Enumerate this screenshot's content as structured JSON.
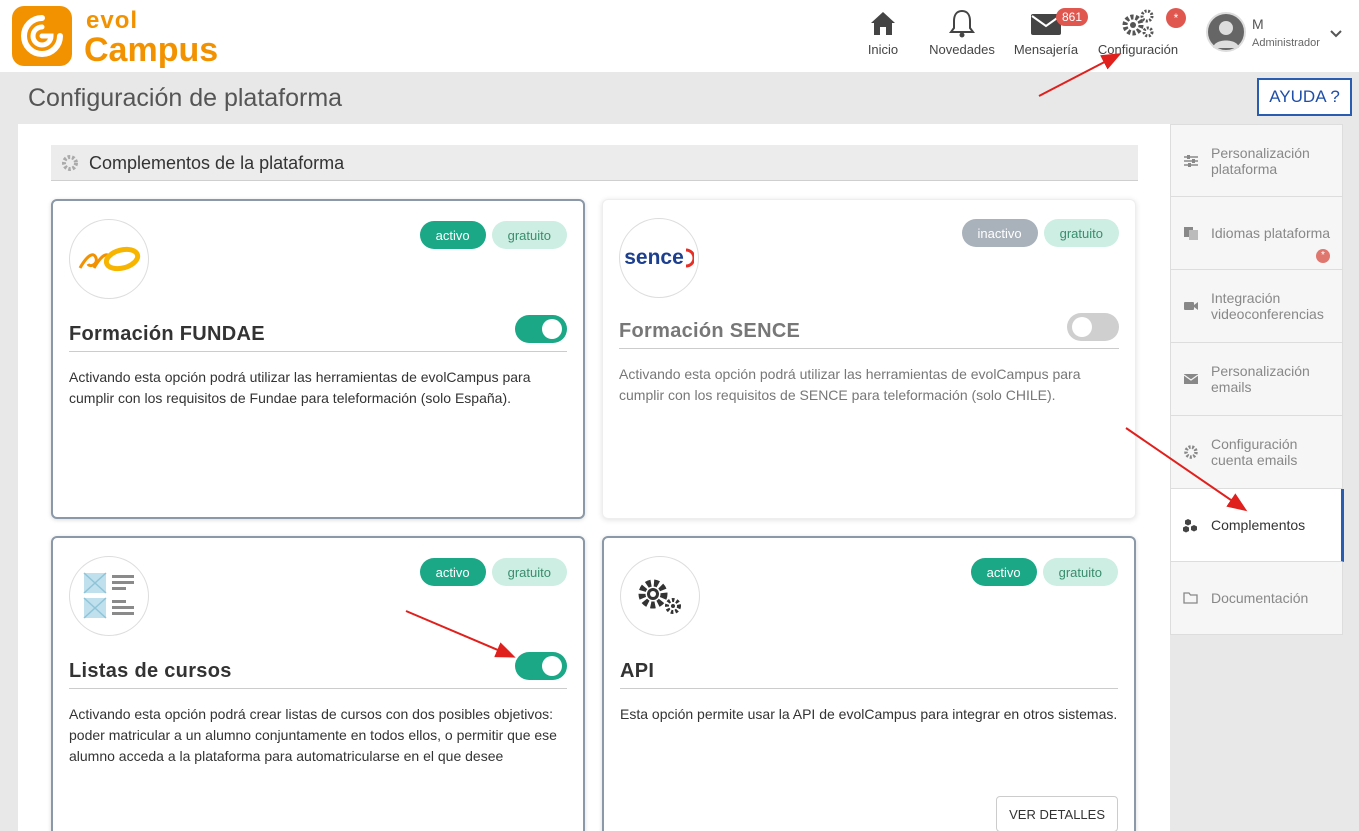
{
  "brand": {
    "top": "evol",
    "bottom": "Campus"
  },
  "nav": [
    {
      "label": "Inicio",
      "icon": "home-icon"
    },
    {
      "label": "Novedades",
      "icon": "bell-icon"
    },
    {
      "label": "Mensajería",
      "icon": "mail-icon",
      "badge": "861"
    },
    {
      "label": "Configuración",
      "icon": "gears-icon",
      "badge": "*"
    }
  ],
  "user": {
    "name": "M",
    "role": "Administrador"
  },
  "page": {
    "title": "Configuración de plataforma",
    "help": "AYUDA ?"
  },
  "section": {
    "title": "Complementos de la plataforma"
  },
  "cards": [
    {
      "title": "Formación FUNDAE",
      "status": "activo",
      "price": "gratuito",
      "enabled": true,
      "description": "Activando esta opción podrá utilizar las herramientas de evolCampus para cumplir con los requisitos de Fundae para teleformación (solo España)."
    },
    {
      "title": "Formación SENCE",
      "status": "inactivo",
      "price": "gratuito",
      "enabled": false,
      "logo_text": "sence",
      "description": "Activando esta opción podrá utilizar las herramientas de evolCampus para cumplir con los requisitos de SENCE para teleformación (solo CHILE)."
    },
    {
      "title": "Listas de cursos",
      "status": "activo",
      "price": "gratuito",
      "enabled": true,
      "description": "Activando esta opción podrá crear listas de cursos con dos posibles objetivos: poder matricular a un alumno conjuntamente en todos ellos, o permitir que ese alumno acceda a la plataforma para automatricularse en el que desee"
    },
    {
      "title": "API",
      "status": "activo",
      "price": "gratuito",
      "description": "Esta opción permite usar la API de evolCampus para integrar en otros sistemas.",
      "button": "VER DETALLES"
    }
  ],
  "sidebar": [
    {
      "label": "Personalización plataforma",
      "icon": "sliders-icon"
    },
    {
      "label": "Idiomas plataforma",
      "icon": "language-icon",
      "badge": "*"
    },
    {
      "label": "Integración videoconferencias",
      "icon": "video-icon"
    },
    {
      "label": "Personalización emails",
      "icon": "envelope-icon"
    },
    {
      "label": "Configuración cuenta emails",
      "icon": "gear-icon"
    },
    {
      "label": "Complementos",
      "icon": "cubes-icon",
      "selected": true
    },
    {
      "label": "Documentación",
      "icon": "folder-icon"
    }
  ],
  "colors": {
    "brand": "#f39200",
    "active": "#1aa886",
    "accent_blue": "#2a5db0",
    "annotation_red": "#e0201c"
  }
}
